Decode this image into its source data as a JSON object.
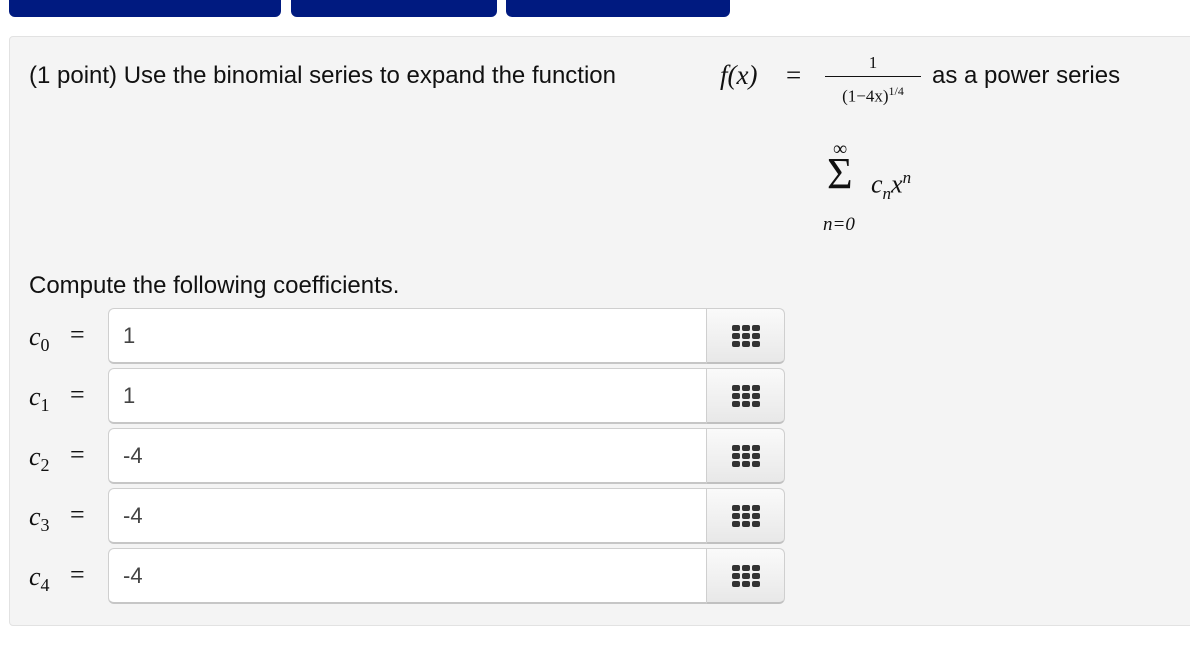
{
  "top_buttons": [
    {
      "label": ""
    },
    {
      "label": ""
    },
    {
      "label": ""
    }
  ],
  "problem": {
    "prefix": "(1 point) Use the binomial series to expand the function",
    "function_name": "f(x)",
    "equals": "=",
    "numerator": "1",
    "denominator_base": "(1−4x)",
    "denominator_exponent": "1/4",
    "suffix": "as a power series",
    "sum_upper": "∞",
    "sum_symbol": "Σ",
    "sum_term_coef": "c",
    "sum_term_coef_sub": "n",
    "sum_term_var": "x",
    "sum_term_var_sup": "n",
    "sum_lower": "n=0"
  },
  "compute_label": "Compute the following coefficients.",
  "coefficients": [
    {
      "label": "c",
      "index": "0",
      "equals": "=",
      "value": "1",
      "icon": "keypad-icon"
    },
    {
      "label": "c",
      "index": "1",
      "equals": "=",
      "value": "1",
      "icon": "keypad-icon"
    },
    {
      "label": "c",
      "index": "2",
      "equals": "=",
      "value": "-4",
      "icon": "keypad-icon"
    },
    {
      "label": "c",
      "index": "3",
      "equals": "=",
      "value": "-4",
      "icon": "keypad-icon"
    },
    {
      "label": "c",
      "index": "4",
      "equals": "=",
      "value": "-4",
      "icon": "keypad-icon"
    }
  ],
  "colors": {
    "top_button": "#001a80",
    "panel_bg": "#f4f4f4"
  }
}
